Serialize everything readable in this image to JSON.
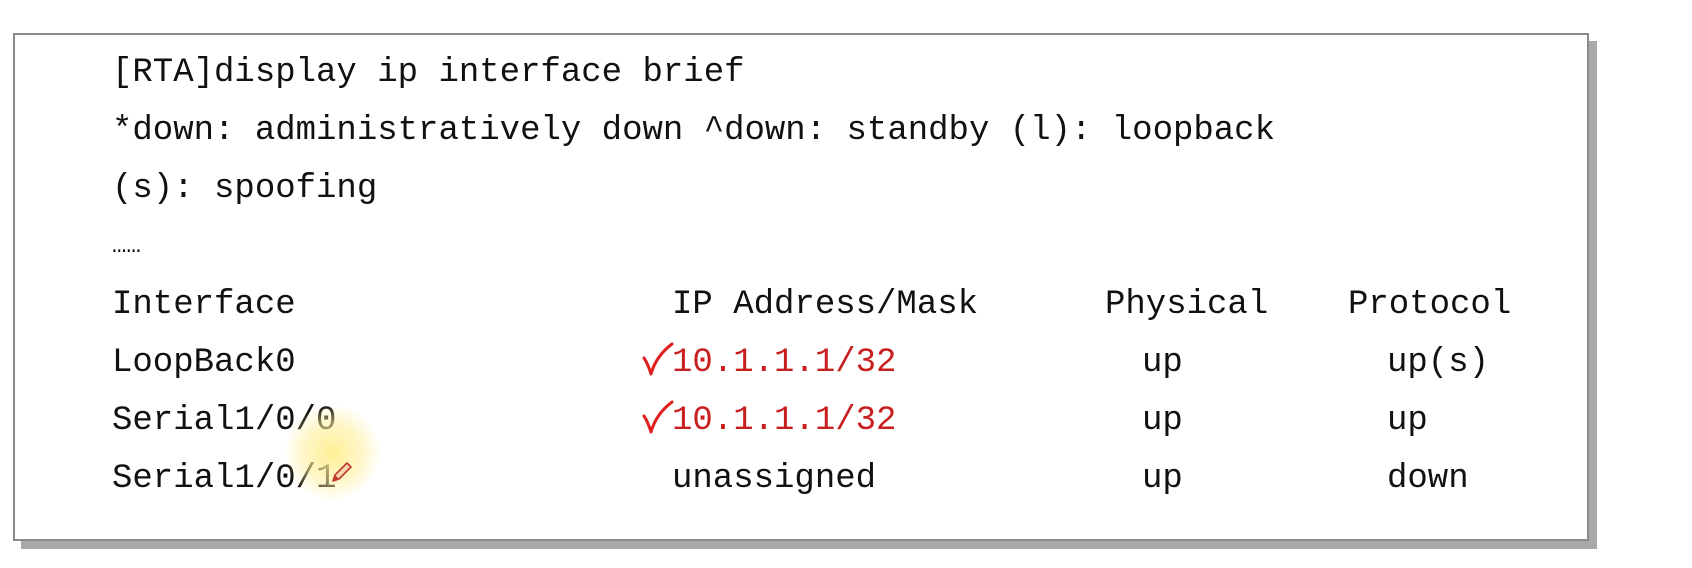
{
  "terminal": {
    "command": "[RTA]display ip interface brief",
    "legend_line1": "*down: administratively down ^down: standby (l): loopback",
    "legend_line2": "(s): spoofing",
    "ellipsis": "……",
    "headers": {
      "interface": "Interface",
      "ip": "IP Address/Mask",
      "physical": "Physical",
      "protocol": "Protocol"
    },
    "rows": [
      {
        "interface": "LoopBack0",
        "ip": "10.1.1.1/32",
        "physical": "up",
        "protocol": "up(s)",
        "checked": true
      },
      {
        "interface": "Serial1/0/0",
        "ip": "10.1.1.1/32",
        "physical": "up",
        "protocol": "up",
        "checked": true
      },
      {
        "interface": "Serial1/0/1",
        "ip": "unassigned",
        "physical": "up",
        "protocol": "down",
        "checked": false
      }
    ]
  },
  "colors": {
    "highlight_ip": "#c81e1e",
    "annotation_mark": "#e02020",
    "cursor_highlight": "#ffec82"
  },
  "icons": [
    "checkmark-icon",
    "pen-cursor-icon"
  ]
}
